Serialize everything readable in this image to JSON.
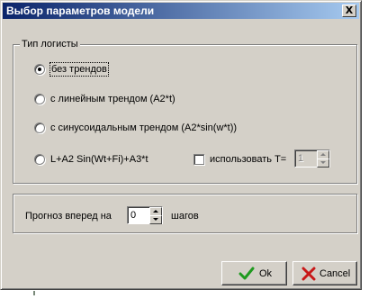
{
  "window": {
    "title": "Выбор параметров модели",
    "close_glyph": "X"
  },
  "logistic_group": {
    "title": "Тип логисты",
    "options": [
      {
        "label": "без трендов",
        "checked": true
      },
      {
        "label": "с линейным трендом (A2*t)",
        "checked": false
      },
      {
        "label": "с синусоидальным трендом (A2*sin(w*t))",
        "checked": false
      },
      {
        "label": "L+A2 Sin(Wt+Fi)+A3*t",
        "checked": false
      }
    ],
    "use_t": {
      "label": "использовать T=",
      "checked": false,
      "value": "1",
      "enabled": false
    }
  },
  "forecast_group": {
    "prefix_label": "Прогноз вперед на",
    "value": "0",
    "suffix_label": "шагов"
  },
  "buttons": {
    "ok_label": "Ok",
    "ok_icon": "checkmark-icon",
    "cancel_label": "Cancel",
    "cancel_icon": "cross-icon"
  },
  "colors": {
    "window_bg": "#d4d0c8",
    "title_start": "#0a246a",
    "title_end": "#a6caf0",
    "ok_icon": "#1f9a1f",
    "cancel_icon": "#c81818"
  }
}
